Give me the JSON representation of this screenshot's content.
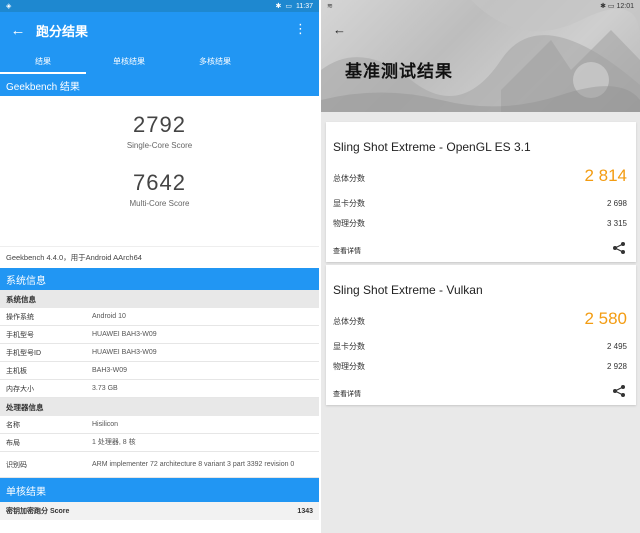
{
  "left": {
    "status_time": "11:37",
    "title": "跑分结果",
    "tabs": [
      "结果",
      "单核结果",
      "多核结果"
    ],
    "section_geekbench": "Geekbench 结果",
    "single_score": "2792",
    "single_label": "Single-Core Score",
    "multi_score": "7642",
    "multi_label": "Multi-Core Score",
    "version_text": "Geekbench 4.4.0，用于Android AArch64",
    "section_sysinfo": "系统信息",
    "subhead_system": "系统信息",
    "sys_rows": [
      {
        "k": "操作系统",
        "v": "Android 10"
      },
      {
        "k": "手机型号",
        "v": "HUAWEI BAH3-W09"
      },
      {
        "k": "手机型号ID",
        "v": "HUAWEI BAH3-W09"
      },
      {
        "k": "主机板",
        "v": "BAH3-W09"
      },
      {
        "k": "内存大小",
        "v": "3.73 GB"
      }
    ],
    "subhead_cpu": "处理器信息",
    "cpu_rows": [
      {
        "k": "名称",
        "v": "Hisilicon"
      },
      {
        "k": "布局",
        "v": "1 处理器, 8 核"
      },
      {
        "k": "识别码",
        "v": "ARM implementer 72 architecture 8 variant 3 part 3392 revision 0"
      }
    ],
    "section_single": "单核结果",
    "bottom_key": "密钥加密跑分 Score",
    "bottom_val": "1343"
  },
  "right": {
    "status_time": "12:01",
    "title": "基准测试结果",
    "cards": [
      {
        "title": "Sling Shot Extreme - OpenGL ES 3.1",
        "total_label": "总体分数",
        "total": "2 814",
        "gpu_label": "显卡分数",
        "gpu": "2 698",
        "phys_label": "物理分数",
        "phys": "3 315",
        "link": "查看详情"
      },
      {
        "title": "Sling Shot Extreme - Vulkan",
        "total_label": "总体分数",
        "total": "2 580",
        "gpu_label": "显卡分数",
        "gpu": "2 495",
        "phys_label": "物理分数",
        "phys": "2 928",
        "link": "查看详情"
      }
    ]
  },
  "colors": {
    "geekbench_blue": "#2196f3",
    "score_orange": "#f39c12"
  }
}
